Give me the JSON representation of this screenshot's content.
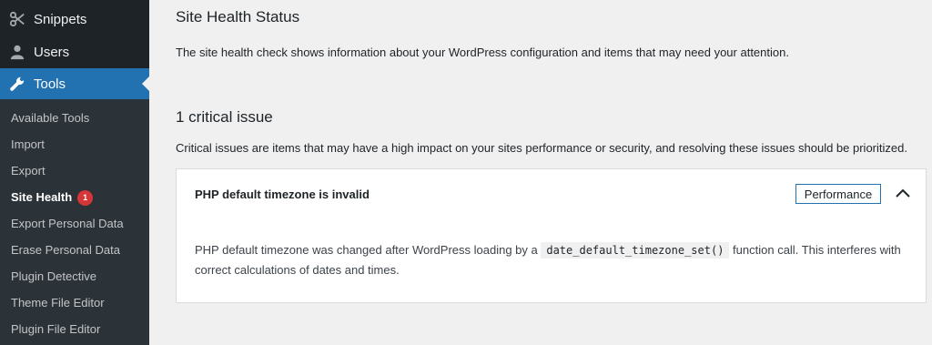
{
  "sidebar": {
    "top_items": [
      {
        "label": "Snippets",
        "icon": "scissors-icon"
      },
      {
        "label": "Users",
        "icon": "user-icon"
      },
      {
        "label": "Tools",
        "icon": "wrench-icon",
        "active": true
      }
    ],
    "submenu": [
      {
        "label": "Available Tools"
      },
      {
        "label": "Import"
      },
      {
        "label": "Export"
      },
      {
        "label": "Site Health",
        "current": true,
        "badge": "1"
      },
      {
        "label": "Export Personal Data"
      },
      {
        "label": "Erase Personal Data"
      },
      {
        "label": "Plugin Detective"
      },
      {
        "label": "Theme File Editor"
      },
      {
        "label": "Plugin File Editor"
      }
    ]
  },
  "main": {
    "title": "Site Health Status",
    "intro": "The site health check shows information about your WordPress configuration and items that may need your attention.",
    "issues_heading": "1 critical issue",
    "issues_desc": "Critical issues are items that may have a high impact on your sites performance or security, and resolving these issues should be prioritized.",
    "issue": {
      "title": "PHP default timezone is invalid",
      "badge": "Performance",
      "body_before": "PHP default timezone was changed after WordPress loading by a ",
      "code": "date_default_timezone_set()",
      "body_after": " function call. This interferes with correct calculations of dates and times."
    }
  },
  "colors": {
    "sidebar_bg": "#1d2327",
    "submenu_bg": "#2c3338",
    "active_bg": "#2271b1",
    "badge_bg": "#d63638"
  }
}
